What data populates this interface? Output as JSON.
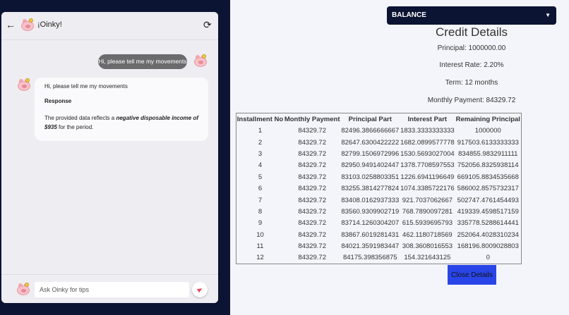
{
  "chat": {
    "title": "¡Oinky!",
    "user_message": "Hi, please tell me my movements",
    "bot_message": {
      "question": "Hi, please tell me my movements",
      "heading": "Response",
      "text_before": "The provided data reflects a ",
      "emphasis": "negative disposable income of $935",
      "text_after": " for the period."
    },
    "input_placeholder": "Ask Oinky for tips"
  },
  "select": {
    "value": "BALANCE"
  },
  "credit": {
    "title": "Credit Details",
    "principal": "Principal: 1000000.00",
    "interest_rate": "Interest Rate: 2.20%",
    "term": "Term: 12 months",
    "monthly_payment": "Monthly Payment: 84329.72",
    "columns": [
      "Installment No",
      "Monthly Payment",
      "Principal Part",
      "Interest Part",
      "Remaining Principal"
    ],
    "rows": [
      [
        "1",
        "84329.72",
        "82496.3866666667",
        "1833.3333333333",
        "1000000"
      ],
      [
        "2",
        "84329.72",
        "82647.6300422222",
        "1682.0899577778",
        "917503.6133333333"
      ],
      [
        "3",
        "84329.72",
        "82799.1506972996",
        "1530.5693027004",
        "834855.9832911111"
      ],
      [
        "4",
        "84329.72",
        "82950.9491402447",
        "1378.7708597553",
        "752056.8325938114"
      ],
      [
        "5",
        "84329.72",
        "83103.0258803351",
        "1226.6941196649",
        "669105.8834535668"
      ],
      [
        "6",
        "84329.72",
        "83255.3814277824",
        "1074.3385722176",
        "586002.8575732317"
      ],
      [
        "7",
        "84329.72",
        "83408.0162937333",
        "921.7037062667",
        "502747.4761454493"
      ],
      [
        "8",
        "84329.72",
        "83560.9309902719",
        "768.7890097281",
        "419339.4598517159"
      ],
      [
        "9",
        "84329.72",
        "83714.1260304207",
        "615.5939695793",
        "335778.5288614441"
      ],
      [
        "10",
        "84329.72",
        "83867.6019281431",
        "462.1180718569",
        "252064.4028310234"
      ],
      [
        "11",
        "84329.72",
        "84021.3591983447",
        "308.3608016553",
        "168196.8009028803"
      ],
      [
        "12",
        "84329.72",
        "84175.398356875",
        "154.321643125",
        "0"
      ]
    ],
    "close_label": "Close Details"
  }
}
